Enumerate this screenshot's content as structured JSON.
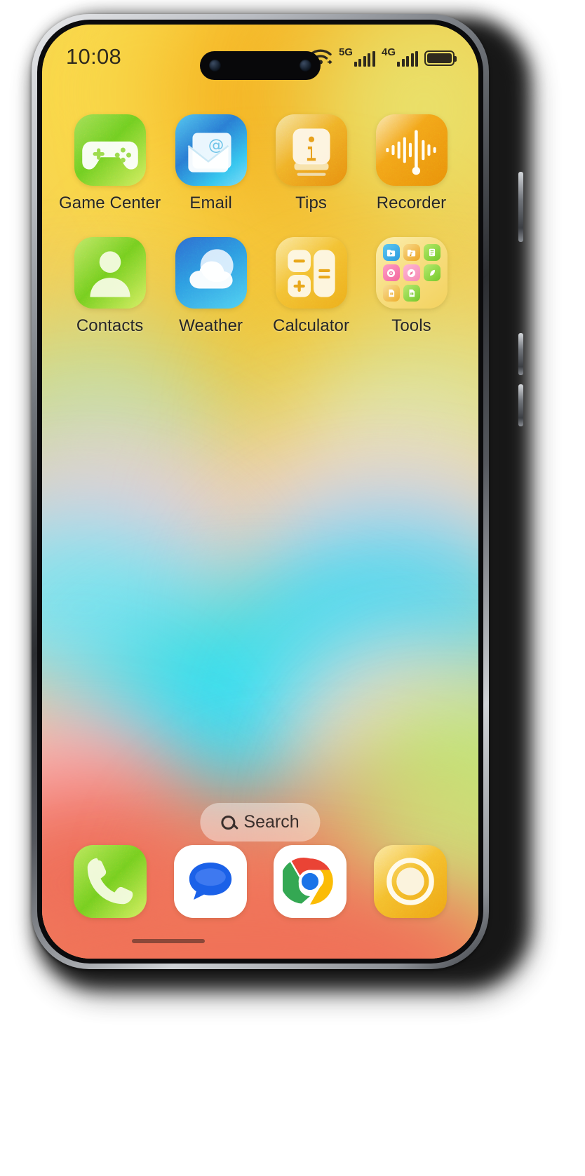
{
  "status_bar": {
    "clock": "10:08",
    "wifi_icon": "wifi-icon",
    "network_primary": "5G",
    "network_secondary": "4G",
    "battery_icon": "battery-icon",
    "text_color": "#2f2a1e"
  },
  "home_screen": {
    "apps": [
      {
        "label": "Game Center",
        "icon": "game-center-icon",
        "color": "#7ed321"
      },
      {
        "label": "Email",
        "icon": "email-icon",
        "color": "#2fb6e8"
      },
      {
        "label": "Tips",
        "icon": "tips-icon",
        "color": "#f0b429"
      },
      {
        "label": "Recorder",
        "icon": "recorder-icon",
        "color": "#f2a81e"
      },
      {
        "label": "Contacts",
        "icon": "contacts-icon",
        "color": "#8bd436"
      },
      {
        "label": "Weather",
        "icon": "weather-icon",
        "color": "#2c9fe0"
      },
      {
        "label": "Calculator",
        "icon": "calculator-icon",
        "color": "#f3c13a"
      },
      {
        "label": "Tools",
        "icon": "tools-folder-icon",
        "color": "#f6dd8a"
      }
    ]
  },
  "search": {
    "label": "Search",
    "icon": "search-icon"
  },
  "dock": {
    "apps": [
      {
        "label": "Phone",
        "icon": "phone-icon",
        "color": "#8bd436"
      },
      {
        "label": "Messages",
        "icon": "messages-icon",
        "color": "#ffffff"
      },
      {
        "label": "Chrome",
        "icon": "chrome-icon",
        "color": "#ffffff"
      },
      {
        "label": "Camera",
        "icon": "camera-icon",
        "color": "#f3c13a"
      }
    ]
  },
  "wallpaper": {
    "description": "abstract blurred gradient",
    "colors": [
      "#f7cf3f",
      "#f6a92a",
      "#ffd7e6",
      "#2fe0ee",
      "#9ae86b",
      "#f0705c",
      "#e8e36a"
    ]
  }
}
